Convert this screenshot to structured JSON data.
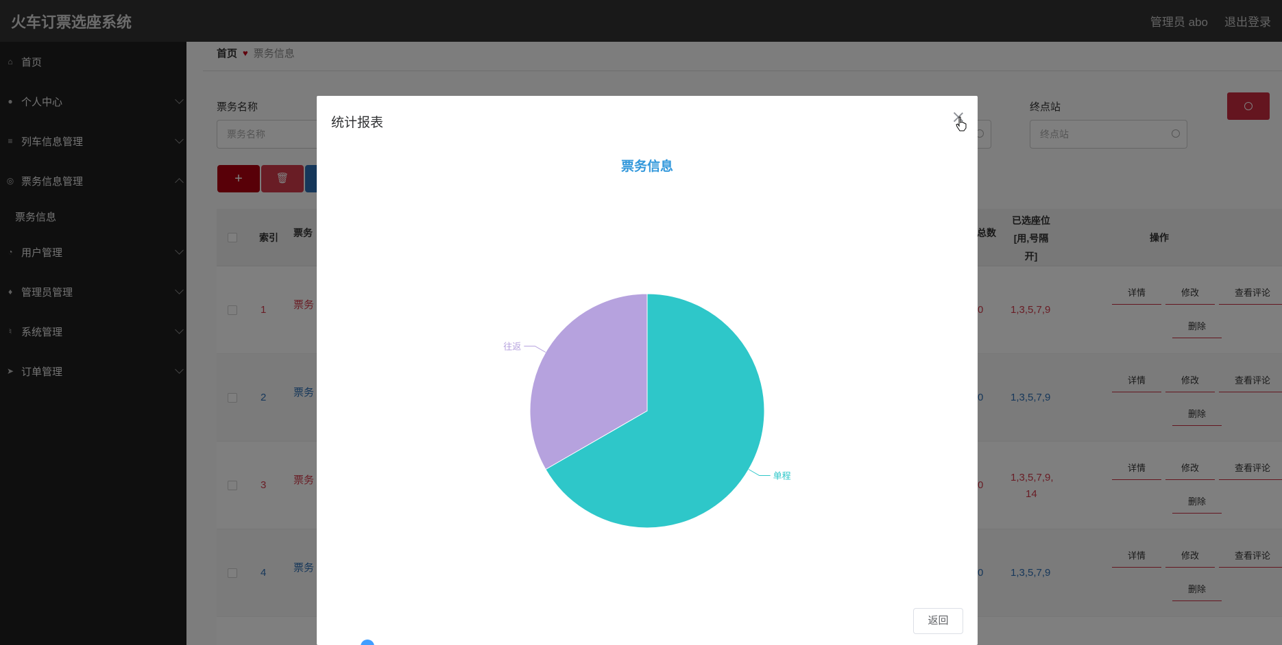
{
  "app": {
    "title": "火车订票选座系统"
  },
  "header": {
    "user": "管理员 abo",
    "logout": "退出登录"
  },
  "sidebar": {
    "items": [
      {
        "label": "首页",
        "icon": "home-icon"
      },
      {
        "label": "个人中心",
        "icon": "user-icon"
      },
      {
        "label": "列车信息管理",
        "icon": "sliders-icon"
      },
      {
        "label": "票务信息管理",
        "icon": "compass-icon"
      },
      {
        "label": "票务信息",
        "icon": ""
      },
      {
        "label": "用户管理",
        "icon": "gauge-icon"
      },
      {
        "label": "管理员管理",
        "icon": "map-pin-icon"
      },
      {
        "label": "系统管理",
        "icon": "mic-icon"
      },
      {
        "label": "订单管理",
        "icon": "send-icon"
      }
    ]
  },
  "breadcrumb": {
    "home": "首页",
    "current": "票务信息"
  },
  "search": {
    "name_label": "票务名称",
    "name_placeholder": "票务名称",
    "end_label": "终点站",
    "end_placeholder": "终点站"
  },
  "toolbar": {
    "add": "+",
    "delete": "🗑"
  },
  "table": {
    "headers": {
      "index": "索引",
      "ticket_name": "票务",
      "total": "总数",
      "selected_seats_1": "已选座位",
      "selected_seats_2": "[用,号隔",
      "selected_seats_3": "开]",
      "actions": "操作"
    },
    "rows": [
      {
        "index": "1",
        "name": "票务",
        "total": "0",
        "seats": "1,3,5,7,9",
        "color": "red"
      },
      {
        "index": "2",
        "name": "票务",
        "total": "0",
        "seats": "1,3,5,7,9",
        "color": "blue"
      },
      {
        "index": "3",
        "name": "票务",
        "total": "0",
        "seats": "1,3,5,7,9,",
        "seats2": "14",
        "color": "red"
      },
      {
        "index": "4",
        "name": "票务",
        "total": "0",
        "seats": "1,3,5,7,9",
        "color": "blue"
      }
    ],
    "actions": {
      "detail": "详情",
      "edit": "修改",
      "comments": "查看评论",
      "delete": "删除"
    }
  },
  "modal": {
    "title": "统计报表",
    "return": "返回"
  },
  "chart_data": {
    "type": "pie",
    "title": "票务信息",
    "slices": [
      {
        "name": "单程",
        "value": 2,
        "color": "#2ec7c9"
      },
      {
        "name": "往返",
        "value": 1,
        "color": "#b6a2de"
      }
    ]
  }
}
